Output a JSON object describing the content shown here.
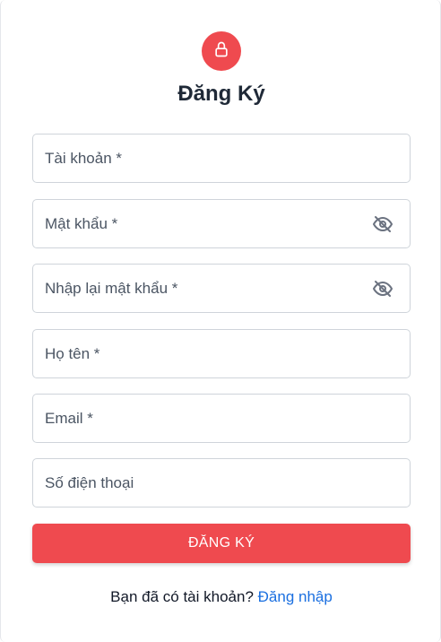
{
  "header": {
    "icon": "lock-icon",
    "accent_color": "#ef4a4f",
    "title": "Đăng Ký"
  },
  "form": {
    "fields": [
      {
        "name": "username",
        "label": "Tài khoản *",
        "value": ""
      },
      {
        "name": "password",
        "label": "Mật khẩu *",
        "value": "",
        "toggle_icon": "eye-off-icon"
      },
      {
        "name": "confirm-password",
        "label": "Nhập lại mật khẩu *",
        "value": "",
        "toggle_icon": "eye-off-icon"
      },
      {
        "name": "full-name",
        "label": "Họ tên *",
        "value": ""
      },
      {
        "name": "email",
        "label": "Email *",
        "value": ""
      },
      {
        "name": "phone",
        "label": "Số điện thoại",
        "value": ""
      }
    ],
    "submit_label": "ĐĂNG KÝ"
  },
  "footer": {
    "prompt": "Bạn đã có tài khoản?",
    "login_link": "Đăng nhập",
    "link_color": "#1a6fe0"
  }
}
